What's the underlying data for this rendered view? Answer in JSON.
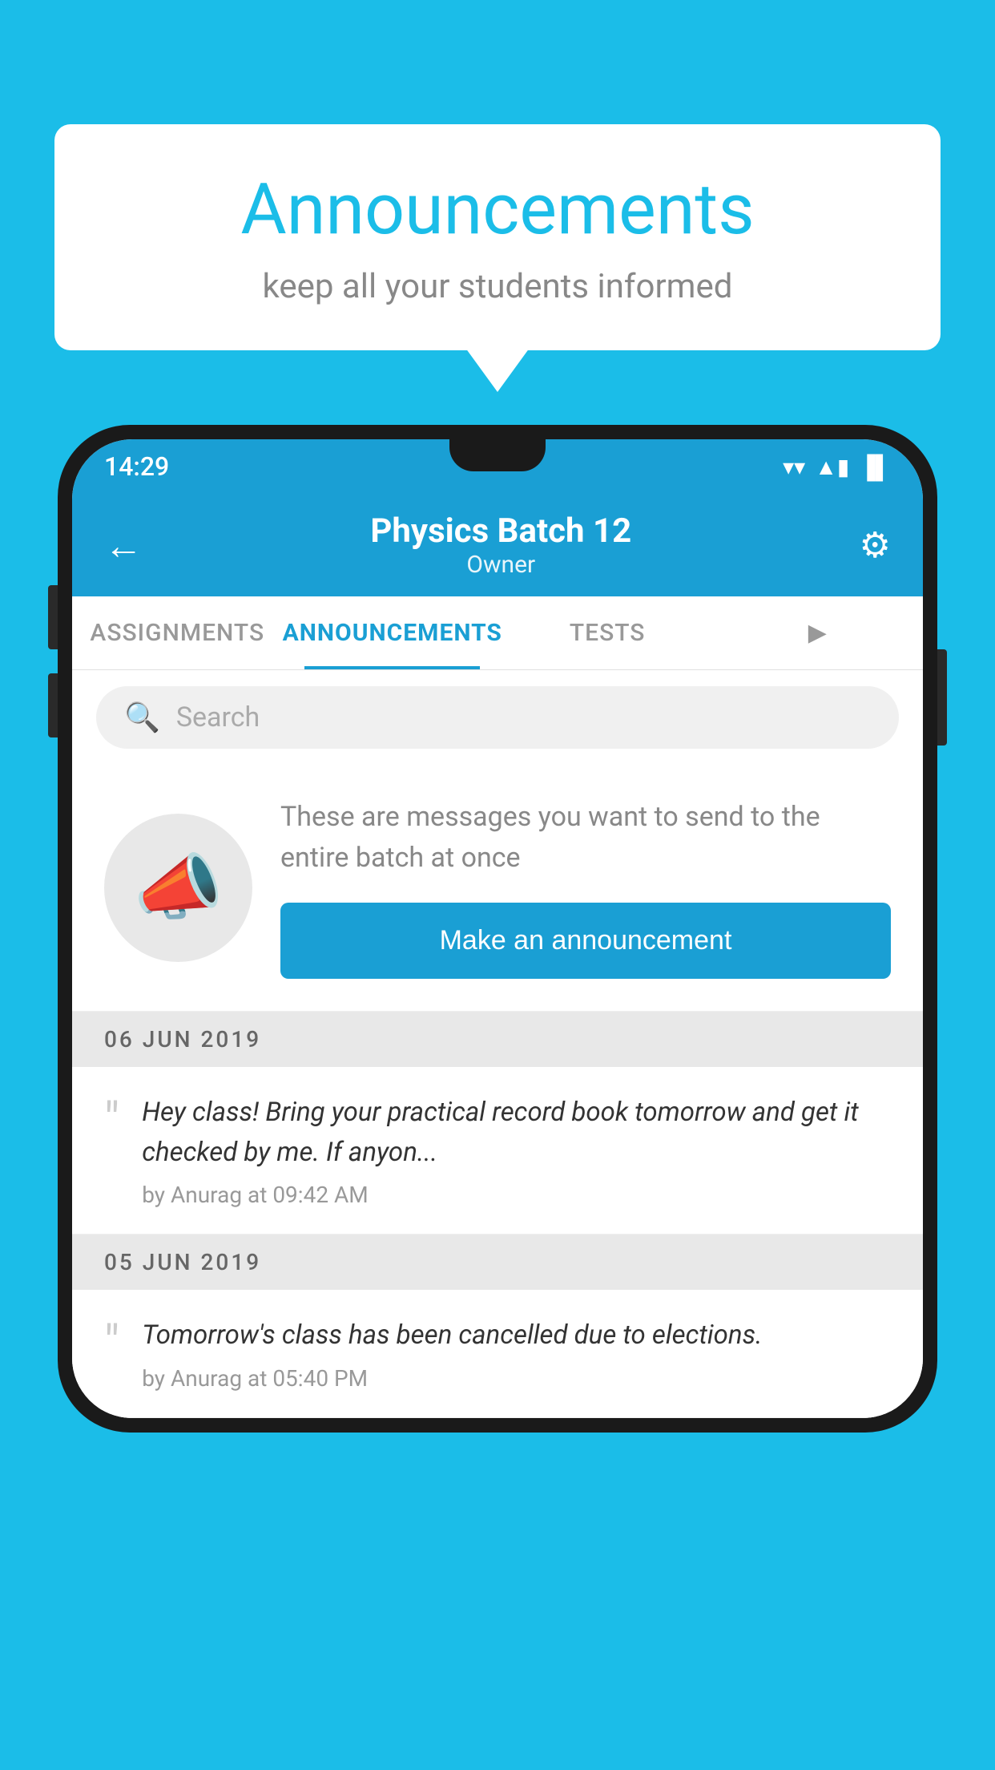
{
  "background_color": "#1BBDE8",
  "speech_bubble": {
    "title": "Announcements",
    "subtitle": "keep all your students informed"
  },
  "status_bar": {
    "time": "14:29",
    "wifi_icon": "▼",
    "signal_icon": "▲",
    "battery_icon": "▐"
  },
  "header": {
    "title": "Physics Batch 12",
    "subtitle": "Owner",
    "back_icon": "←",
    "settings_icon": "⚙"
  },
  "tabs": [
    {
      "label": "ASSIGNMENTS",
      "active": false
    },
    {
      "label": "ANNOUNCEMENTS",
      "active": true
    },
    {
      "label": "TESTS",
      "active": false
    },
    {
      "label": "...",
      "active": false
    }
  ],
  "search": {
    "placeholder": "Search",
    "icon": "🔍"
  },
  "announcement_prompt": {
    "description": "These are messages you want to send to the entire batch at once",
    "button_label": "Make an announcement"
  },
  "date_sections": [
    {
      "date": "06  JUN  2019",
      "items": [
        {
          "text": "Hey class! Bring your practical record book tomorrow and get it checked by me. If anyon...",
          "meta": "by Anurag at 09:42 AM"
        }
      ]
    },
    {
      "date": "05  JUN  2019",
      "items": [
        {
          "text": "Tomorrow's class has been cancelled due to elections.",
          "meta": "by Anurag at 05:40 PM"
        }
      ]
    }
  ]
}
